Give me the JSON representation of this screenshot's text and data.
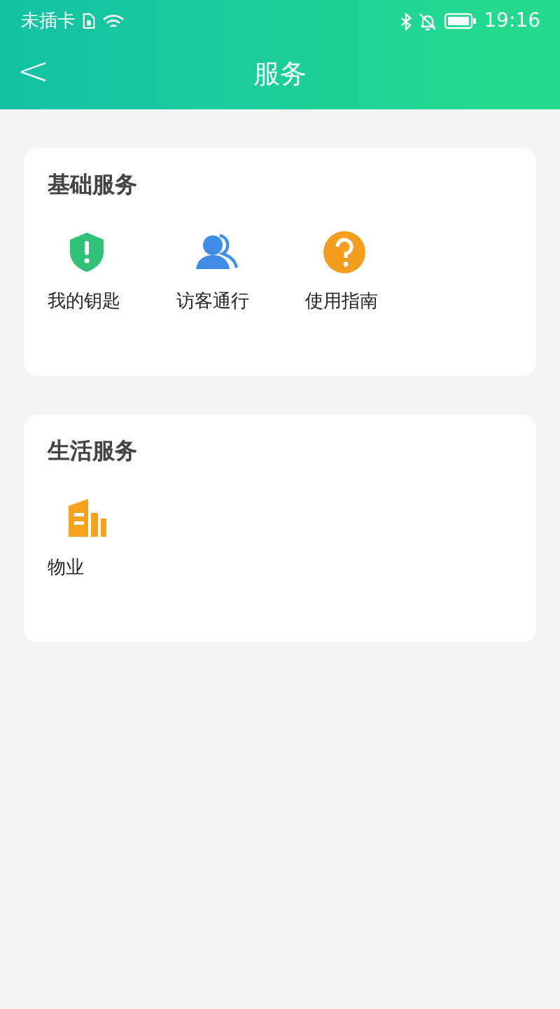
{
  "status_bar": {
    "carrier": "未插卡",
    "time": "19:16"
  },
  "header": {
    "back": "<",
    "title": "服务"
  },
  "sections": [
    {
      "title": "基础服务",
      "items": [
        {
          "label": "我的钥匙",
          "kind": "shield"
        },
        {
          "label": "访客通行",
          "kind": "people"
        },
        {
          "label": "使用指南",
          "kind": "question"
        }
      ]
    },
    {
      "title": "生活服务",
      "items": [
        {
          "label": "物业",
          "kind": "building"
        }
      ]
    }
  ]
}
